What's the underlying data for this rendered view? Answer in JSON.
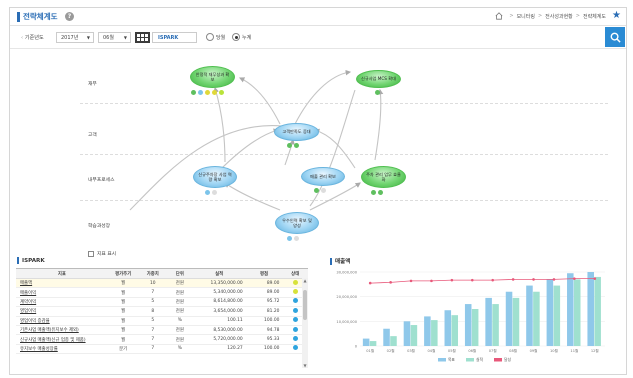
{
  "header": {
    "title": "전략체계도",
    "breadcrumb": [
      "모니터링",
      "전사성과현황",
      "전략체계도"
    ]
  },
  "filter": {
    "label": "기준년도",
    "year": "2017년",
    "month": "06월",
    "target": "ISPARK",
    "radio_single": "당월",
    "radio_cumulative": "누계",
    "selected": "누계"
  },
  "map": {
    "perspectives": [
      "재무",
      "고객",
      "내부프로세스",
      "학습과성장"
    ],
    "nodes": [
      {
        "id": "n1",
        "label": "안정적 재무성과 확보",
        "color": "green"
      },
      {
        "id": "n2",
        "label": "신규사업 MCS 확대",
        "color": "green"
      },
      {
        "id": "n3",
        "label": "고객만족도 증대",
        "color": "blue"
      },
      {
        "id": "n4",
        "label": "신규주차장 사업 역량 확보",
        "color": "blue"
      },
      {
        "id": "n5",
        "label": "매출 관리 확보",
        "color": "blue"
      },
      {
        "id": "n6",
        "label": "주차 관리 업무 효율화",
        "color": "green"
      },
      {
        "id": "n7",
        "label": "우수인력 확보 및 양성",
        "color": "blue"
      }
    ],
    "show_label": "지표 표시"
  },
  "table": {
    "title": "ISPARK",
    "columns": [
      "지표",
      "평가주기",
      "가중치",
      "단위",
      "실적",
      "평점",
      "상태"
    ],
    "rows": [
      [
        "매출액",
        "월",
        "10",
        "천원",
        "13,350,000.00",
        "89.00",
        "#d7e23a"
      ],
      [
        "매출이익",
        "월",
        "7",
        "천원",
        "5,340,000.00",
        "89.00",
        "#d7e23a"
      ],
      [
        "계약이익",
        "월",
        "5",
        "천원",
        "8,614,800.00",
        "95.72",
        "#2fa4de"
      ],
      [
        "영업이익",
        "월",
        "8",
        "천원",
        "3,654,000.00",
        "81.20",
        "#2fa4de"
      ],
      [
        "영업이익 증감율",
        "월",
        "5",
        "%",
        "100.11",
        "100.00",
        "#2fa4de"
      ],
      [
        "기존사업 매출액(유지보수 제외)",
        "월",
        "7",
        "천원",
        "8,530,000.00",
        "94.78",
        "#2fa4de"
      ],
      [
        "신규사업 매출액(신규 업종 및 제품)",
        "월",
        "7",
        "천원",
        "5,720,000.00",
        "95.33",
        "#2fa4de"
      ],
      [
        "유지보수 매출성장률",
        "분기",
        "7",
        "%",
        "120.27",
        "100.00",
        "#2fa4de"
      ]
    ]
  },
  "chart_data": {
    "type": "bar",
    "title": "매출액",
    "categories": [
      "01월",
      "02월",
      "03월",
      "04월",
      "05월",
      "06월",
      "07월",
      "08월",
      "09월",
      "10월",
      "11월",
      "12월"
    ],
    "series": [
      {
        "name": "목표",
        "type": "bar",
        "color": "#8fc8ea",
        "values": [
          3000000,
          7000000,
          10000000,
          12000000,
          14500000,
          17000000,
          19500000,
          22000000,
          24500000,
          27000000,
          29500000,
          30000000
        ]
      },
      {
        "name": "실적",
        "type": "bar",
        "color": "#9fe0cf",
        "values": [
          2000000,
          4000000,
          8500000,
          10500000,
          12500000,
          15000000,
          17000000,
          19500000,
          22000000,
          24500000,
          27000000,
          28000000
        ]
      },
      {
        "name": "달성",
        "type": "line",
        "color": "#e8587a",
        "values": [
          85,
          86,
          88,
          88,
          89,
          89,
          89,
          90,
          90,
          90,
          91,
          91
        ]
      }
    ],
    "y_ticks": [
      "30,000,000",
      "20,000,000",
      "10,000,000",
      "0"
    ],
    "ylim": [
      0,
      30000000
    ],
    "line_ylim": [
      0,
      100
    ],
    "legend": "bottom"
  },
  "colors": {
    "accent": "#2a6db5",
    "search": "#2a8bd4"
  }
}
